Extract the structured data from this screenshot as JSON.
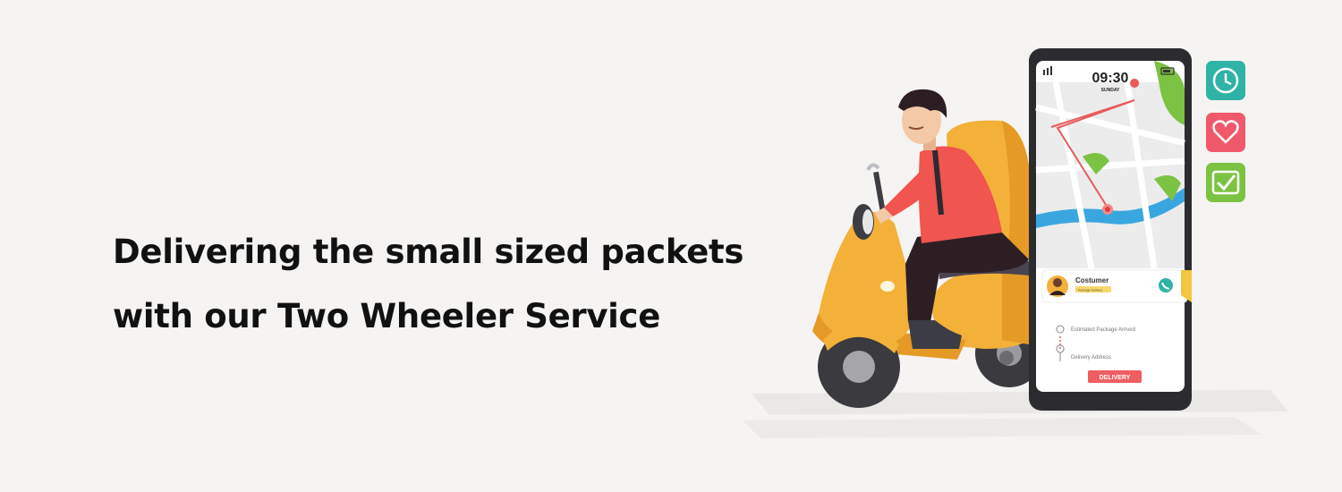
{
  "headline": {
    "line1": "Delivering the small sized packets",
    "line2": "with our Two Wheeler Service"
  },
  "phone": {
    "time": "09:30",
    "day": "SUNDAY",
    "customer_label": "Costumer",
    "tag_label": "Package Delivery",
    "estimated_label": "Estimated Package Arrived",
    "address_label": "Delivery Address",
    "delivery_button": "DELIVERY"
  },
  "icons": [
    "clock-icon",
    "heart-icon",
    "check-icon",
    "phone-call-icon",
    "location-pin-icon"
  ],
  "colors": {
    "background": "#f5f4f2",
    "scooter": "#f3b13a",
    "shirt": "#f0554f",
    "teal": "#2fb3a6",
    "red_tile": "#f0596b",
    "green_tile": "#7cc243",
    "river": "#3aa6e0",
    "button": "#ee5e63"
  }
}
